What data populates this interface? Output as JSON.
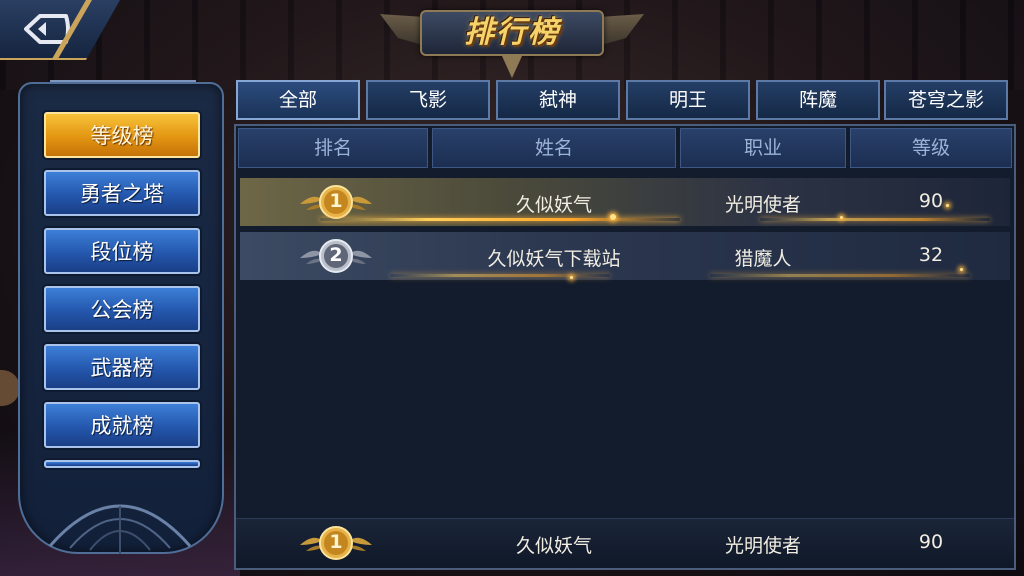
{
  "title": "排行榜",
  "categories": [
    {
      "label": "等级榜",
      "active": true
    },
    {
      "label": "勇者之塔",
      "active": false
    },
    {
      "label": "段位榜",
      "active": false
    },
    {
      "label": "公会榜",
      "active": false
    },
    {
      "label": "武器榜",
      "active": false
    },
    {
      "label": "成就榜",
      "active": false
    }
  ],
  "tabs": [
    "全部",
    "飞影",
    "弑神",
    "明王",
    "阵魔",
    "苍穹之影"
  ],
  "columns": [
    "排名",
    "姓名",
    "职业",
    "等级"
  ],
  "rows": [
    {
      "rank": "1",
      "name": "久似妖气",
      "class": "光明使者",
      "level": "90"
    },
    {
      "rank": "2",
      "name": "久似妖气下载站",
      "class": "猎魔人",
      "level": "32"
    }
  ],
  "my_rank": {
    "rank": "1",
    "name": "久似妖气",
    "class": "光明使者",
    "level": "90"
  },
  "colors": {
    "gold": "#e3a12a",
    "silver": "#9aa3b3",
    "tab_blue": "#243e66",
    "active_orange": "#e39612"
  },
  "icons": [
    "back-icon",
    "gold-medal-icon",
    "silver-medal-icon"
  ]
}
